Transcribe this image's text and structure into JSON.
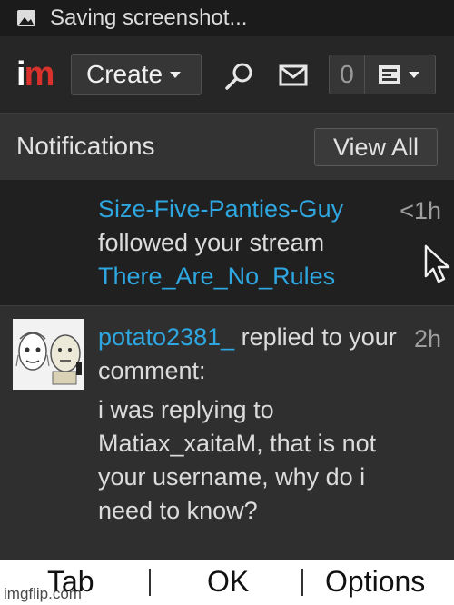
{
  "status_bar": {
    "text": "Saving screenshot...",
    "icon": "image-icon"
  },
  "nav": {
    "logo_part1": "i",
    "logo_part2": "m",
    "create_label": "Create",
    "search_icon": "search-icon",
    "mail_icon": "mail-icon",
    "notification_count": "0",
    "user_menu_icon": "user-avatar-icon",
    "colors": {
      "logo_red": "#d9312b",
      "bar_bg": "#262626"
    }
  },
  "notifications": {
    "title": "Notifications",
    "view_all_label": "View All",
    "items": [
      {
        "user": "Size-Five-Panties-Guy",
        "action": "followed your stream",
        "target": "There_Are_No_Rules",
        "time": "<1h"
      },
      {
        "user": "potato2381_",
        "action": " replied to your comment:",
        "comment": "i was replying to Matiax_xaitaM, that is not your username, why do i need to know?",
        "time": "2h"
      }
    ],
    "link_color": "#2ea6e0"
  },
  "softkeys": {
    "tab": "Tab",
    "ok": "OK",
    "options": "Options"
  },
  "watermark": "imgflip.com"
}
